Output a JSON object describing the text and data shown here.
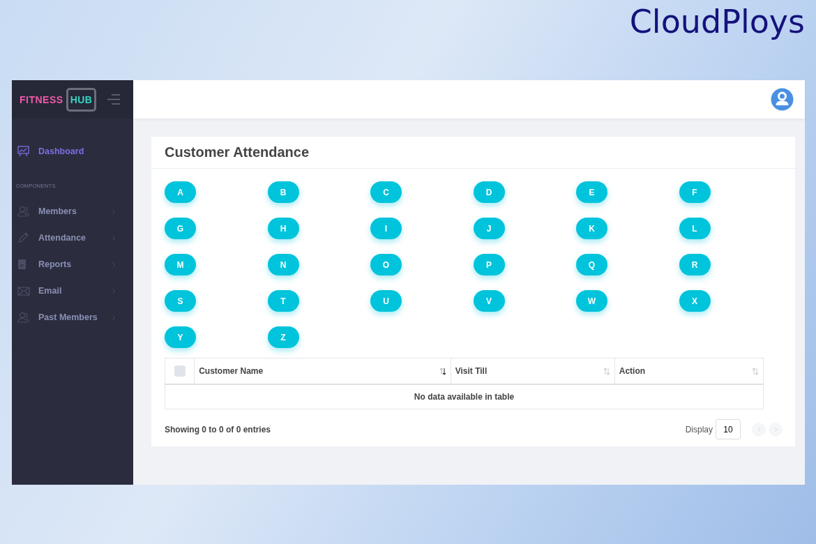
{
  "brand": {
    "name": "CloudPloys"
  },
  "sidebar": {
    "logo": {
      "word_1": "FITNESS",
      "word_2": "HUB"
    },
    "items": [
      {
        "label": "Dashboard",
        "kind": "chart",
        "selected": true,
        "submenu": false
      },
      {
        "label": "COMPONENTS",
        "kind": "heading"
      },
      {
        "label": "Members",
        "kind": "users",
        "selected": false,
        "submenu": true
      },
      {
        "label": "Attendance",
        "kind": "pencil",
        "selected": false,
        "submenu": true
      },
      {
        "label": "Reports",
        "kind": "file",
        "selected": false,
        "submenu": true
      },
      {
        "label": "Email",
        "kind": "mail",
        "selected": false,
        "submenu": true
      },
      {
        "label": "Past Members",
        "kind": "users",
        "selected": false,
        "submenu": true
      }
    ]
  },
  "card": {
    "title": "Customer Attendance",
    "letters": [
      "A",
      "B",
      "C",
      "D",
      "E",
      "F",
      "G",
      "H",
      "I",
      "J",
      "K",
      "L",
      "M",
      "N",
      "O",
      "P",
      "Q",
      "R",
      "S",
      "T",
      "U",
      "V",
      "W",
      "X",
      "Y",
      "Z"
    ],
    "table": {
      "select_all": {
        "checked": false
      },
      "columns": [
        {
          "label": "Customer Name",
          "sorted": true
        },
        {
          "label": "Visit Till",
          "sorted": false
        },
        {
          "label": "Action",
          "sorted": false
        }
      ],
      "empty_message": "No data available in table"
    },
    "footer": {
      "info": "Showing 0 to 0 of 0 entries",
      "display_label": "Display",
      "display_value": "10",
      "prev_disabled": true,
      "next_disabled": true
    }
  }
}
